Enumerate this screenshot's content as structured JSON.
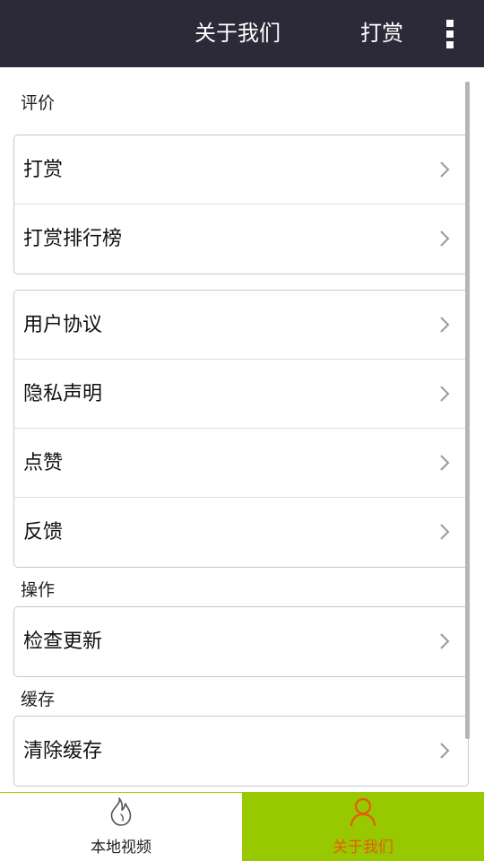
{
  "header": {
    "title": "关于我们",
    "reward": "打赏",
    "more_icon": "more-vertical-icon"
  },
  "sections": [
    {
      "label": "评价"
    },
    {
      "label": "操作"
    },
    {
      "label": "缓存"
    }
  ],
  "groups": {
    "review": [
      "打赏",
      "打赏排行榜"
    ],
    "info": [
      "用户协议",
      "隐私声明",
      "点赞",
      "反馈"
    ],
    "ops": [
      "检查更新"
    ],
    "cache": [
      "清除缓存"
    ]
  },
  "bottom_nav": {
    "local_video": "本地视频",
    "about_us": "关于我们",
    "active_color": "#97c800",
    "active_label_color": "#e85a0c"
  },
  "colors": {
    "header_bg": "#2c2a39"
  }
}
